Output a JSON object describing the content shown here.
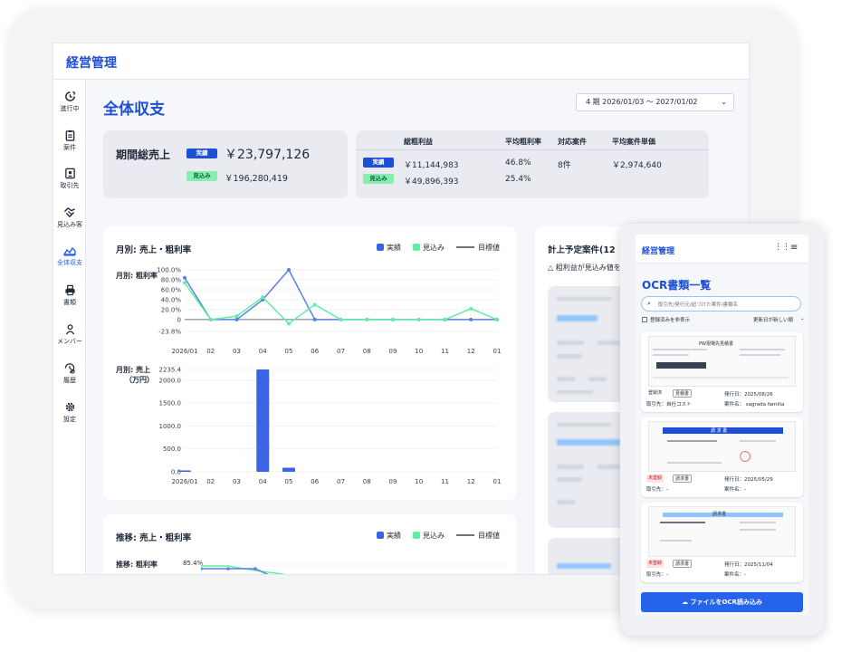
{
  "app": {
    "title": "経営管理"
  },
  "sidebar": {
    "items": [
      {
        "label": "進行中",
        "icon": "progress-icon"
      },
      {
        "label": "案件",
        "icon": "clipboard-icon"
      },
      {
        "label": "取引先",
        "icon": "contact-card-icon"
      },
      {
        "label": "見込み客",
        "icon": "handshake-icon"
      },
      {
        "label": "全体収支",
        "icon": "area-chart-icon",
        "active": true
      },
      {
        "label": "書類",
        "icon": "printer-icon"
      },
      {
        "label": "メンバー",
        "icon": "person-icon"
      },
      {
        "label": "履歴",
        "icon": "history-icon"
      },
      {
        "label": "設定",
        "icon": "gear-icon"
      }
    ]
  },
  "page": {
    "title": "全体収支",
    "period": "4 期 2026/01/03 〜 2027/01/02"
  },
  "sales": {
    "label": "期間総売上",
    "actual_badge": "実績",
    "actual_value": "￥23,797,126",
    "forecast_badge": "見込み",
    "forecast_value": "￥196,280,419"
  },
  "profit": {
    "headers": [
      "総粗利益",
      "平均粗利率",
      "対応案件",
      "平均案件単価"
    ],
    "actual": {
      "badge": "実績",
      "gross": "￥11,144,983",
      "rate": "46.8%",
      "count": "8件",
      "avg": "￥2,974,640"
    },
    "forecast": {
      "badge": "見込み",
      "gross": "￥49,896,393",
      "rate": "25.4%"
    }
  },
  "monthly": {
    "title": "月別: 売上・粗利率",
    "legend": {
      "actual": "実績",
      "forecast": "見込み",
      "target": "目標値"
    },
    "rate_label": "月別: 粗利率",
    "sales_label_1": "月別: 売上",
    "sales_label_2": "（万円）"
  },
  "trend": {
    "title": "推移: 売上・粗利率",
    "legend": {
      "actual": "実績",
      "forecast": "見込み",
      "target": "目標値"
    },
    "rate_label": "推移: 粗利率",
    "rate_tick": "85.4%"
  },
  "planned": {
    "title": "計上予定案件(12",
    "note": "△ 粗利益が見込み値を下"
  },
  "chart_data": [
    {
      "type": "line",
      "title": "月別: 粗利率",
      "categories": [
        "2026/01",
        "02",
        "03",
        "04",
        "05",
        "06",
        "07",
        "08",
        "09",
        "10",
        "11",
        "12",
        "01"
      ],
      "yticks": [
        "100.0%",
        "80.0%",
        "60.0%",
        "40.0%",
        "20.0%",
        "0",
        "-23.8%"
      ],
      "ylim": [
        -23.8,
        100
      ],
      "series": [
        {
          "name": "実績",
          "color": "#5b7fe8",
          "values": [
            84,
            0,
            0,
            40,
            100,
            0,
            0,
            0,
            0,
            0,
            0,
            0,
            0
          ]
        },
        {
          "name": "見込み",
          "color": "#5ef0a0",
          "values": [
            74,
            0,
            7,
            45,
            -8,
            30,
            0,
            0,
            0,
            0,
            0,
            22,
            0
          ]
        }
      ]
    },
    {
      "type": "bar",
      "title": "月別: 売上（万円）",
      "categories": [
        "2026/01",
        "02",
        "03",
        "04",
        "05",
        "06",
        "07",
        "08",
        "09",
        "10",
        "11",
        "12",
        "01"
      ],
      "yticks": [
        "2235.4",
        "2000.0",
        "1500.0",
        "1000.0",
        "500.0",
        "0.0"
      ],
      "ylim": [
        0,
        2235.4
      ],
      "series": [
        {
          "name": "実績",
          "color": "#3b63e6",
          "values": [
            30,
            0,
            0,
            2235.4,
            90,
            0,
            0,
            0,
            0,
            0,
            0,
            0,
            0
          ]
        }
      ]
    }
  ],
  "mobile": {
    "app_title": "経営管理",
    "page_title": "OCR書類一覧",
    "search_placeholder": "取引先/発行元/紐づけた案件/書類名",
    "hide_registered": "登録済みを非表示",
    "sort": "更新日が新しい順",
    "upload": "ファイルをOCR読み込み",
    "docs": [
      {
        "status": "登録済",
        "registered": true,
        "kind": "見積書",
        "issued": "発行日：2025/08/26",
        "partner": "取引先：自社コスト",
        "project": "案件名： sagrada familia",
        "doc_heading": "PW現場先見積書"
      },
      {
        "status": "未登録",
        "registered": false,
        "kind": "請求書",
        "issued": "発行日：2025/05/29",
        "partner": "取引先：-",
        "project": "案件名：-",
        "doc_heading": "請 求 書"
      },
      {
        "status": "未登録",
        "registered": false,
        "kind": "請求書",
        "issued": "発行日：2025/11/04",
        "partner": "取引先：-",
        "project": "案件名：-",
        "doc_heading": "請求書"
      }
    ]
  }
}
